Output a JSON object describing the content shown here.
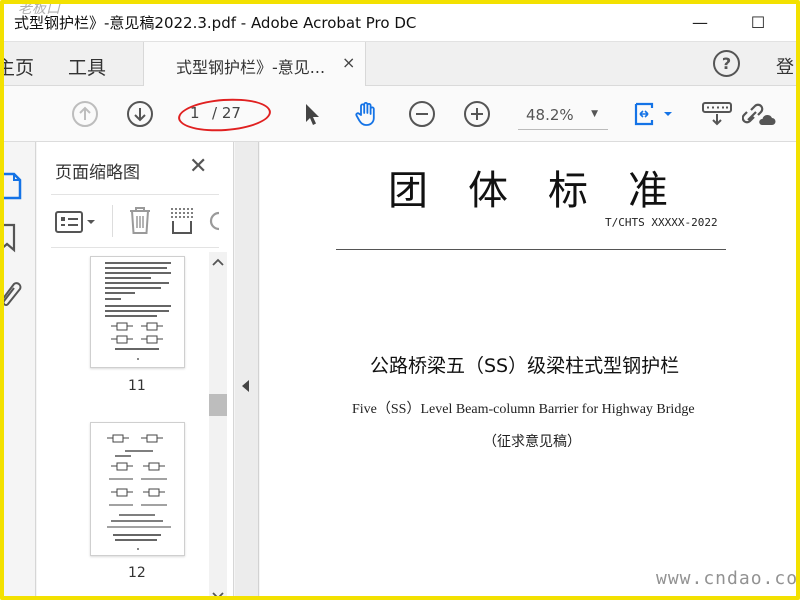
{
  "window": {
    "title": "式型钢护栏》-意见稿2022.3.pdf - Adobe Acrobat Pro DC",
    "watermark": "老板口",
    "minimize": "—",
    "maximize": "☐"
  },
  "tabs": {
    "home": "主页",
    "tools": "工具",
    "document": "式型钢护栏》-意见...",
    "close": "×",
    "help": "?",
    "login": "登"
  },
  "toolbar": {
    "current_page": "1",
    "page_total": "/ 27",
    "zoom": "48.2%",
    "zoom_caret": "▼"
  },
  "thumbnail_panel": {
    "title": "页面缩略图",
    "close": "✕",
    "pages": [
      {
        "number": "11"
      },
      {
        "number": "12"
      }
    ]
  },
  "document": {
    "heading": "团体标准",
    "code": "T/CHTS XXXXX-2022",
    "title_cn": "公路桥梁五（SS）级梁柱式型钢护栏",
    "title_en": "Five（SS）Level Beam-column Barrier for Highway Bridge",
    "note": "（征求意见稿）"
  },
  "site_watermark": "www.cndao.com",
  "colors": {
    "frame": "#f3e100",
    "accent_blue": "#1473e6",
    "annotation_red": "#e02020"
  }
}
